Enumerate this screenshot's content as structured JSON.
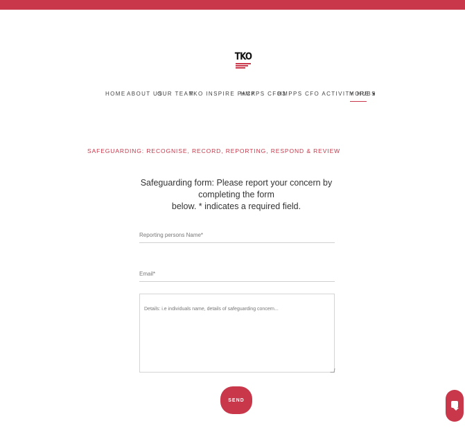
{
  "brand": {
    "logo_text": "TKO"
  },
  "nav": {
    "items": [
      {
        "label": "HOME"
      },
      {
        "label": "ABOUT US"
      },
      {
        "label": "OUR TEAM"
      },
      {
        "label": "TKO INSPIRE PACK"
      },
      {
        "label": "HMPPS CFO3"
      },
      {
        "label": "HMPPS CFO ACTIVITY HUBS"
      },
      {
        "label": "MORE ▾"
      }
    ]
  },
  "section": {
    "label": "SAFEGUARDING: RECOGNISE, RECORD, REPORTING, RESPOND & REVIEW"
  },
  "form": {
    "title_line1": "Safeguarding form: Please report your concern by completing the form",
    "title_line2": "below. * indicates a required field.",
    "name_placeholder": "Reporting persons Name*",
    "email_placeholder": "Email*",
    "details_placeholder": "Details: i.e individuals name, details of safeguarding concern...",
    "send_label": "SEND"
  },
  "colors": {
    "accent": "#c8374a"
  },
  "icons": {
    "chat": "chat-icon"
  }
}
